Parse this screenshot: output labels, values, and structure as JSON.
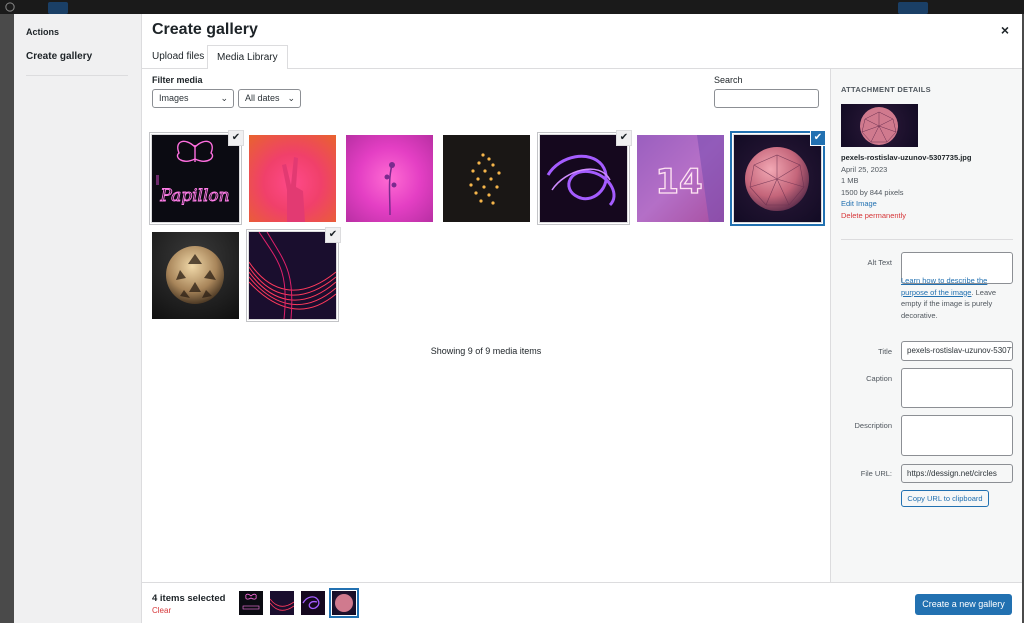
{
  "modal": {
    "title": "Create gallery",
    "close_label": "×"
  },
  "menu": {
    "heading": "Actions",
    "items": [
      {
        "label": "Create gallery"
      }
    ]
  },
  "tabs": [
    {
      "label": "Upload files"
    },
    {
      "label": "Media Library"
    }
  ],
  "filter": {
    "label": "Filter media",
    "type_value": "Images",
    "date_value": "All dates",
    "search_label": "Search",
    "search_value": ""
  },
  "media": [
    {
      "icon": "butterfly-neon-image",
      "selected": true,
      "active": false
    },
    {
      "icon": "peace-hand-image",
      "selected": false,
      "active": false
    },
    {
      "icon": "pink-flower-image",
      "selected": false,
      "active": false
    },
    {
      "icon": "string-lights-image",
      "selected": false,
      "active": false
    },
    {
      "icon": "purple-light-trails-image",
      "selected": true,
      "active": false
    },
    {
      "icon": "neon-14-image",
      "selected": false,
      "active": false
    },
    {
      "icon": "polygon-sphere-image",
      "selected": true,
      "active": true
    },
    {
      "icon": "gold-sphere-image",
      "selected": false,
      "active": false
    },
    {
      "icon": "red-light-trails-image",
      "selected": true,
      "active": false
    }
  ],
  "showing_text": "Showing 9 of 9 media items",
  "attachment": {
    "heading": "ATTACHMENT DETAILS",
    "filename": "pexels-rostislav-uzunov-5307735.jpg",
    "date": "April 25, 2023",
    "size": "1 MB",
    "dimensions": "1500 by 844 pixels",
    "edit_link": "Edit Image",
    "delete_link": "Delete permanently",
    "alt_label": "Alt Text",
    "alt_value": "",
    "help_link": "Learn how to describe the purpose of the image",
    "help_text": ". Leave empty if the image is purely decorative.",
    "title_label": "Title",
    "title_value": "pexels-rostislav-uzunov-5307735",
    "caption_label": "Caption",
    "caption_value": "",
    "description_label": "Description",
    "description_value": "",
    "url_label": "File URL:",
    "url_value": "https://dessign.net/circles",
    "copy_label": "Copy URL to clipboard"
  },
  "toolbar": {
    "selected_count": "4 items selected",
    "clear_label": "Clear",
    "create_label": "Create a new gallery"
  },
  "colors": {
    "accent": "#2271b1",
    "danger": "#d63638"
  }
}
